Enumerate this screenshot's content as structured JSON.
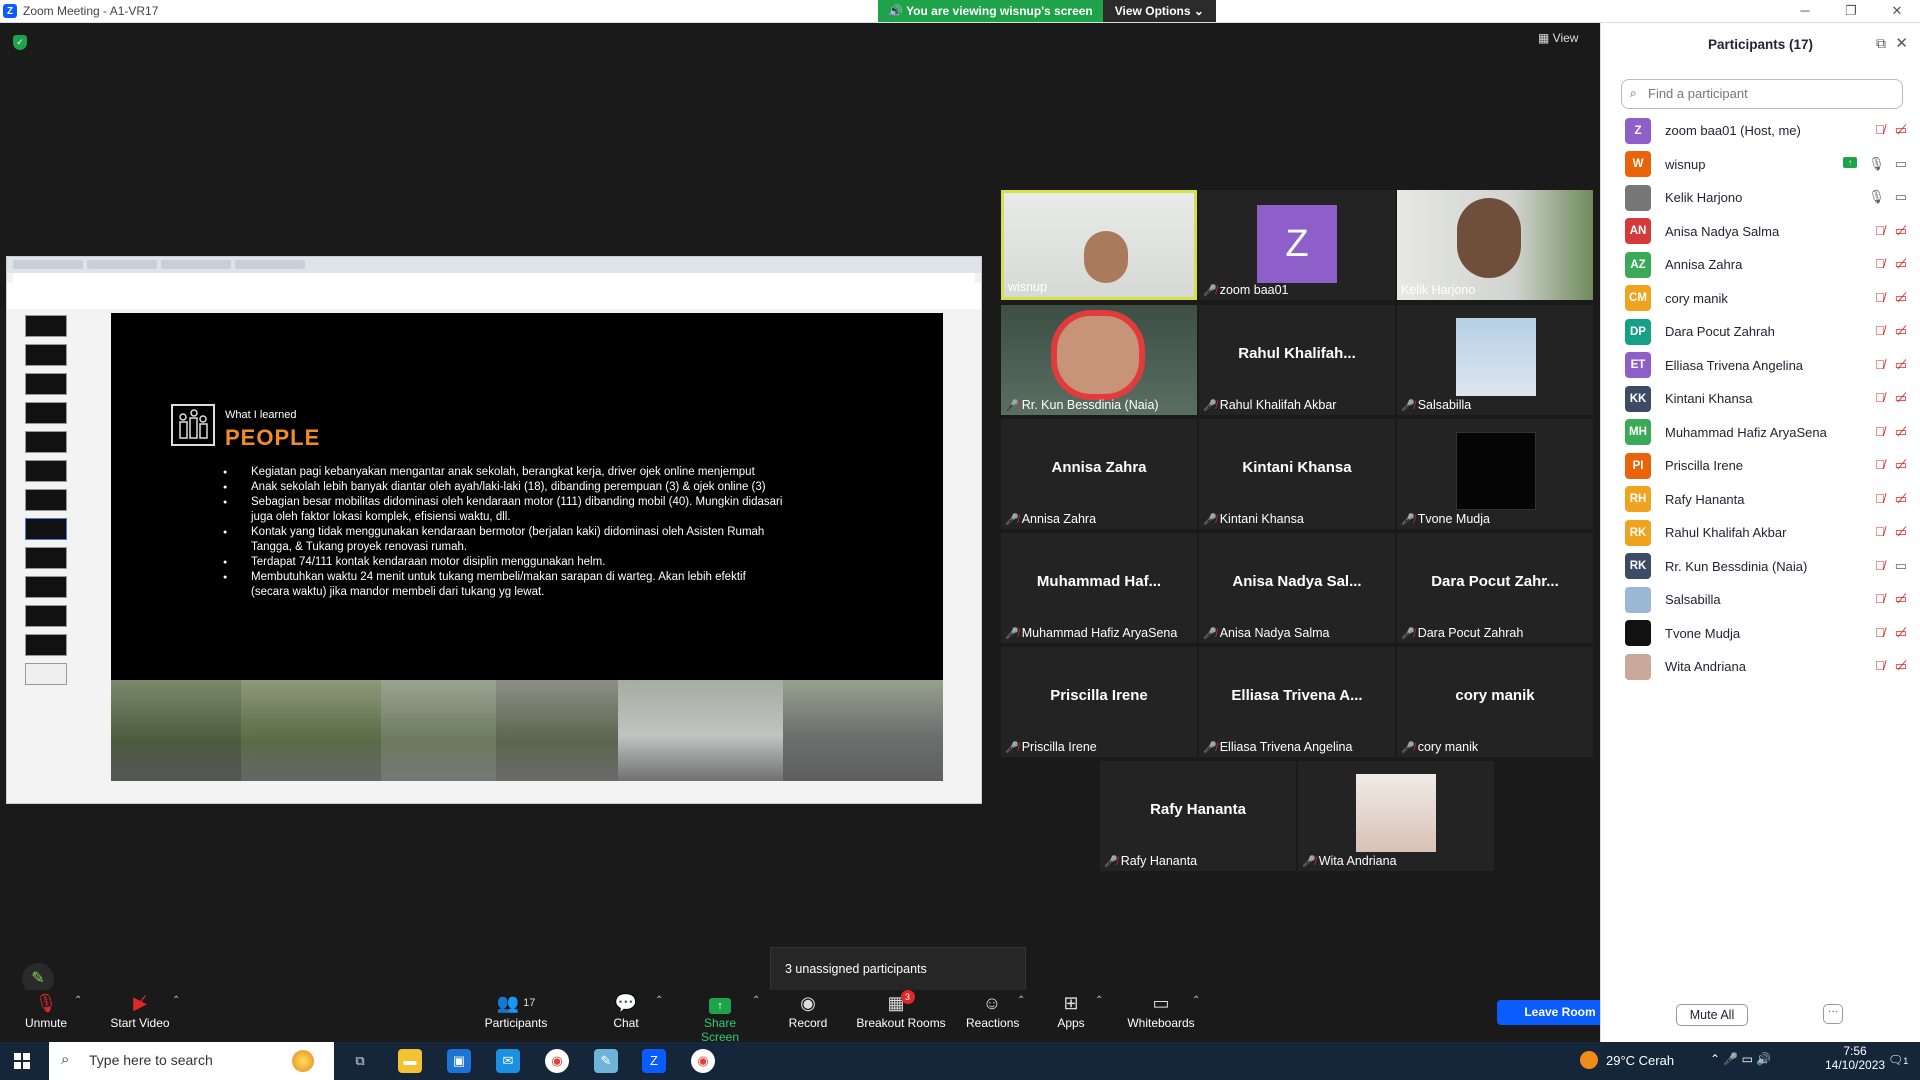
{
  "window": {
    "title": "Zoom Meeting - A1-VR17",
    "logo": "Z",
    "controls": [
      "─",
      "❐",
      "✕"
    ]
  },
  "banner": {
    "viewing": "You are viewing wisnup's screen",
    "view_options": "View Options"
  },
  "view_button": "View",
  "slide": {
    "what_i_learned": "What I learned",
    "heading": "PEOPLE",
    "bullets": [
      "Kegiatan pagi kebanyakan mengantar anak sekolah, berangkat kerja, driver ojek online menjemput",
      "Anak sekolah lebih banyak diantar oleh ayah/laki-laki (18), dibanding perempuan (3) & ojek online (3)",
      "Sebagian besar mobilitas didominasi oleh kendaraan motor (111) dibanding mobil (40). Mungkin didasari juga oleh faktor lokasi komplek, efisiensi waktu, dll.",
      "Kontak yang tidak menggunakan kendaraan bermotor (berjalan kaki) didominasi oleh Asisten Rumah Tangga, & Tukang proyek renovasi rumah.",
      "Terdapat 74/111 kontak kendaraan motor disiplin menggunakan helm.",
      "Membutuhkan waktu 24 menit untuk tukang membeli/makan sarapan di warteg. Akan lebih efektif (secara waktu) jika mandor membeli dari tukang yg lewat."
    ]
  },
  "tiles": [
    {
      "label": "wisnup",
      "big": "",
      "muted": false,
      "photo": "wisnup"
    },
    {
      "label": "zoom baa01",
      "big": "Z",
      "muted": true,
      "photo": "z-avatar"
    },
    {
      "label": "Kelik Harjono",
      "big": "",
      "muted": false,
      "photo": "kelik"
    },
    {
      "label": "Rr. Kun Bessdinia (Naia)",
      "big": "",
      "muted": true,
      "photo": "naia"
    },
    {
      "label": "Rahul Khalifah Akbar",
      "big": "Rahul  Khalifah...",
      "muted": true,
      "photo": ""
    },
    {
      "label": "Salsabilla",
      "big": "",
      "muted": true,
      "photo": "salsabilla"
    },
    {
      "label": "Annisa Zahra",
      "big": "Annisa Zahra",
      "muted": true,
      "photo": ""
    },
    {
      "label": "Kintani Khansa",
      "big": "Kintani Khansa",
      "muted": true,
      "photo": ""
    },
    {
      "label": "Tvone Mudja",
      "big": "",
      "muted": true,
      "photo": "tvone"
    },
    {
      "label": "Muhammad Hafiz AryaSena",
      "big": "Muhammad  Haf...",
      "muted": true,
      "photo": ""
    },
    {
      "label": "Anisa Nadya Salma",
      "big": "Anisa  Nadya Sal...",
      "muted": true,
      "photo": ""
    },
    {
      "label": "Dara Pocut Zahrah",
      "big": "Dara Pocut  Zahr...",
      "muted": true,
      "photo": ""
    },
    {
      "label": "Priscilla Irene",
      "big": "Priscilla Irene",
      "muted": true,
      "photo": ""
    },
    {
      "label": "Elliasa Trivena Angelina",
      "big": "Elliasa  Trivena  A...",
      "muted": true,
      "photo": ""
    },
    {
      "label": "cory manik",
      "big": "cory manik",
      "muted": true,
      "photo": ""
    },
    {
      "label": "Rafy Hananta",
      "big": "Rafy Hananta",
      "muted": true,
      "photo": ""
    },
    {
      "label": "Wita Andriana",
      "big": "",
      "muted": true,
      "photo": "wita"
    }
  ],
  "toolbar": {
    "unmute": "Unmute",
    "start_video": "Start Video",
    "participants": "Participants",
    "participants_count": "17",
    "chat": "Chat",
    "share_screen": "Share Screen",
    "record": "Record",
    "breakout": "Breakout Rooms",
    "breakout_badge": "3",
    "reactions": "Reactions",
    "apps": "Apps",
    "whiteboards": "Whiteboards",
    "leave": "Leave Room"
  },
  "unassigned": "3 unassigned participants",
  "panel": {
    "title": "Participants (17)",
    "search_placeholder": "Find a participant",
    "mute_all": "Mute All",
    "more": "···",
    "participants": [
      {
        "initials": "Z",
        "name": "zoom baa01 (Host, me)",
        "color": "#8e5fc9",
        "mic": "off",
        "video": "off"
      },
      {
        "initials": "W",
        "name": "wisnup",
        "color": "#e8630a",
        "mic": "on",
        "video": "on",
        "sharing": true
      },
      {
        "initials": "",
        "name": "Kelik Harjono",
        "color": "#777777",
        "mic": "on",
        "video": "on",
        "photo": true
      },
      {
        "initials": "AN",
        "name": "Anisa Nadya Salma",
        "color": "#d43a3a",
        "mic": "off",
        "video": "off"
      },
      {
        "initials": "AZ",
        "name": "Annisa Zahra",
        "color": "#3aaa58",
        "mic": "off",
        "video": "off"
      },
      {
        "initials": "CM",
        "name": "cory manik",
        "color": "#f0a31e",
        "mic": "off",
        "video": "off"
      },
      {
        "initials": "DP",
        "name": "Dara Pocut Zahrah",
        "color": "#16a085",
        "mic": "off",
        "video": "off"
      },
      {
        "initials": "ET",
        "name": "Elliasa Trivena Angelina",
        "color": "#8e5fc9",
        "mic": "off",
        "video": "off"
      },
      {
        "initials": "KK",
        "name": "Kintani Khansa",
        "color": "#3d4b66",
        "mic": "off",
        "video": "off"
      },
      {
        "initials": "MH",
        "name": "Muhammad Hafiz AryaSena",
        "color": "#3aaa58",
        "mic": "off",
        "video": "off"
      },
      {
        "initials": "PI",
        "name": "Priscilla Irene",
        "color": "#e8630a",
        "mic": "off",
        "video": "off"
      },
      {
        "initials": "RH",
        "name": "Rafy Hananta",
        "color": "#f0a31e",
        "mic": "off",
        "video": "off"
      },
      {
        "initials": "RK",
        "name": "Rahul Khalifah Akbar",
        "color": "#f0a31e",
        "mic": "off",
        "video": "off"
      },
      {
        "initials": "RK",
        "name": "Rr. Kun Bessdinia (Naia)",
        "color": "#3d4b66",
        "mic": "off",
        "video": "on"
      },
      {
        "initials": "",
        "name": "Salsabilla",
        "color": "#9bb8d6",
        "mic": "off",
        "video": "off",
        "photo": true
      },
      {
        "initials": "",
        "name": "Tvone Mudja",
        "color": "#111111",
        "mic": "off",
        "video": "off",
        "photo": true
      },
      {
        "initials": "",
        "name": "Wita Andriana",
        "color": "#c9a89a",
        "mic": "off",
        "video": "off",
        "photo": true
      }
    ]
  },
  "taskbar": {
    "search_placeholder": "Type here to search",
    "weather": "29°C  Cerah",
    "time": "7:56",
    "date": "14/10/2023",
    "notif": "1"
  }
}
